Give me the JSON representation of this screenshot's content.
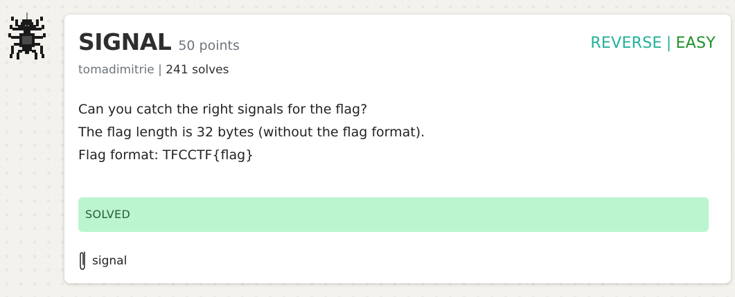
{
  "challenge": {
    "title": "SIGNAL",
    "points": "50 points",
    "author": "tomadimitrie",
    "separator": "|",
    "solves": "241 solves",
    "category": "REVERSE",
    "difficulty": "EASY",
    "description": [
      "Can you catch the right signals for the flag?",
      "The flag length is 32 bytes (without the flag format).",
      "Flag format: TFCCTF{flag}"
    ],
    "status": "SOLVED",
    "attachment": "signal"
  },
  "colors": {
    "category": "#21b19a",
    "difficulty": "#1e8f2a",
    "solved_bg": "#baf5d0"
  },
  "icons": {
    "mascot": "spider-icon",
    "attachment": "paperclip-icon"
  }
}
